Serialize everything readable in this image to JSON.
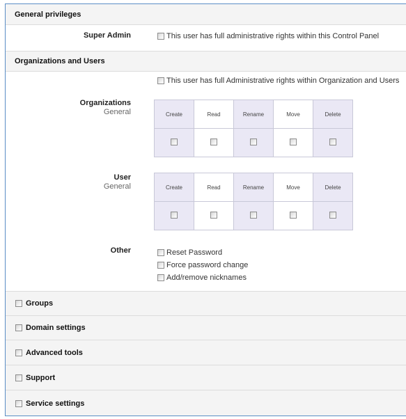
{
  "general": {
    "title": "General privileges",
    "super_admin_label": "Super Admin",
    "super_admin_text": "This user has full administrative rights within this Control Panel"
  },
  "org_users": {
    "title": "Organizations and Users",
    "full_rights_text": "This user has full Administrative rights within Organization and Users",
    "organizations": {
      "label": "Organizations",
      "sub": "General",
      "columns": [
        "Create",
        "Read",
        "Rename",
        "Move",
        "Delete"
      ]
    },
    "user": {
      "label": "User",
      "sub": "General",
      "columns": [
        "Create",
        "Read",
        "Rename",
        "Move",
        "Delete"
      ]
    },
    "other": {
      "label": "Other",
      "options": [
        "Reset Password",
        "Force password change",
        "Add/remove nicknames"
      ]
    }
  },
  "collapsed_sections": [
    "Groups",
    "Domain settings",
    "Advanced tools",
    "Support",
    "Service settings"
  ]
}
